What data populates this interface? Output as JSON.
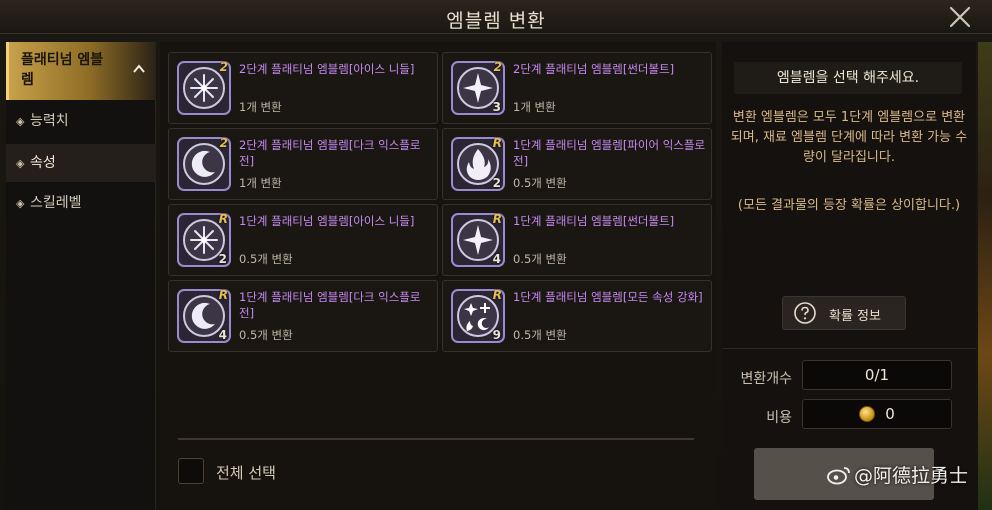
{
  "window": {
    "title": "엠블렘 변환"
  },
  "sidebar": {
    "header_label": "플래티넘 엠블렘",
    "items": [
      {
        "label": "능력치",
        "active": false
      },
      {
        "label": "속성",
        "active": true
      },
      {
        "label": "스킬레벨",
        "active": false
      }
    ]
  },
  "cards": [
    {
      "name": "2단계 플래티넘 엠블렘[아이스 니들]",
      "value": "1개 변환",
      "tier": "2",
      "count": "",
      "icon": "snowflake-icon",
      "frame": "#9a8bd1"
    },
    {
      "name": "2단계 플래티넘 엠블렘[썬더볼트]",
      "value": "1개 변환",
      "tier": "2",
      "count": "3",
      "icon": "star-burst-icon",
      "frame": "#9a8bd1"
    },
    {
      "name": "2단계 플래티넘 엠블렘[다크 익스플로전]",
      "value": "1개 변환",
      "tier": "2",
      "count": "",
      "icon": "crescent-moon-icon",
      "frame": "#9a8bd1"
    },
    {
      "name": "1단계 플래티넘 엠블렘[파이어 익스플로전]",
      "value": "0.5개 변환",
      "tier": "R",
      "count": "2",
      "icon": "flame-icon",
      "frame": "#9a8bd1"
    },
    {
      "name": "1단계 플래티넘 엠블렘[아이스 니들]",
      "value": "0.5개 변환",
      "tier": "R",
      "count": "2",
      "icon": "snowflake-icon",
      "frame": "#9a8bd1"
    },
    {
      "name": "1단계 플래티넘 엠블렘[썬더볼트]",
      "value": "0.5개 변환",
      "tier": "R",
      "count": "4",
      "icon": "star-burst-icon",
      "frame": "#9a8bd1"
    },
    {
      "name": "1단계 플래티넘 엠블렘[다크 익스플로전]",
      "value": "0.5개 변환",
      "tier": "R",
      "count": "4",
      "icon": "crescent-moon-icon",
      "frame": "#9a8bd1"
    },
    {
      "name": "1단계 플래티넘 엠블렘[모든 속성 강화]",
      "value": "0.5개 변환",
      "tier": "R",
      "count": "9",
      "icon": "all-elements-icon",
      "frame": "#9a8bd1"
    }
  ],
  "select_all": {
    "label": "전체 선택",
    "checked": false
  },
  "info": {
    "prompt": "엠블렘을 선택 해주세요.",
    "body": "변환 엠블렘은 모두 1단계 엠블렘으로 변환되며, 재료 엠블렘 단계에 따라 변환 가능 수량이 달라집니다.",
    "note": "(모든 결과물의 등장 확률은 상이합니다.)",
    "prob_button": "확률 정보",
    "count_label": "변환개수",
    "count_value": "0/1",
    "cost_label": "비용",
    "cost_value": "0"
  },
  "watermark": "@阿德拉勇士",
  "colors": {
    "accent_gold": "#c7a14a",
    "name_purple": "#c58bf2",
    "hint_tan": "#d9b98a"
  }
}
